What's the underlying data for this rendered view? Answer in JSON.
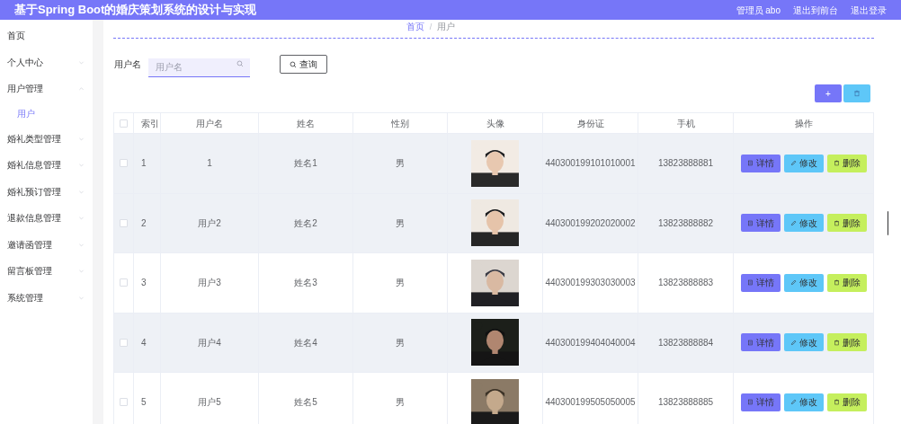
{
  "header": {
    "title": "基于Spring Boot的婚庆策划系统的设计与实现",
    "user": "管理员 abo",
    "links": [
      "退出到前台",
      "退出登录"
    ]
  },
  "sidebar": {
    "items": [
      {
        "label": "首页",
        "kind": "link"
      },
      {
        "label": "个人中心",
        "kind": "menu",
        "expanded": false
      },
      {
        "label": "用户管理",
        "kind": "menu",
        "expanded": true,
        "children": [
          {
            "label": "用户",
            "selected": true
          }
        ]
      },
      {
        "label": "婚礼类型管理",
        "kind": "menu",
        "expanded": false
      },
      {
        "label": "婚礼信息管理",
        "kind": "menu",
        "expanded": false
      },
      {
        "label": "婚礼预订管理",
        "kind": "menu",
        "expanded": false
      },
      {
        "label": "退款信息管理",
        "kind": "menu",
        "expanded": false
      },
      {
        "label": "邀请函管理",
        "kind": "menu",
        "expanded": false
      },
      {
        "label": "留言板管理",
        "kind": "menu",
        "expanded": false
      },
      {
        "label": "系统管理",
        "kind": "menu",
        "expanded": false
      }
    ]
  },
  "breadcrumb": {
    "items": [
      "首页",
      "用户"
    ],
    "separator": "/"
  },
  "search": {
    "label": "用户名",
    "placeholder": "用户名",
    "button": "查询"
  },
  "toolbar": {
    "add": "+"
  },
  "table": {
    "columns": [
      "索引",
      "用户名",
      "姓名",
      "性别",
      "头像",
      "身份证",
      "手机",
      "操作"
    ],
    "header_checked": false,
    "rows": [
      {
        "checked": false,
        "highlighted": true,
        "index": "1",
        "username": "1",
        "name": "姓名1",
        "gender": "男",
        "id_card": "440300199101010001",
        "phone": "13823888881",
        "actions": [
          "详情",
          "修改",
          "删除"
        ]
      },
      {
        "checked": false,
        "highlighted": true,
        "index": "2",
        "username": "用户2",
        "name": "姓名2",
        "gender": "男",
        "id_card": "440300199202020002",
        "phone": "13823888882",
        "actions": [
          "详情",
          "修改",
          "删除"
        ]
      },
      {
        "checked": false,
        "highlighted": false,
        "index": "3",
        "username": "用户3",
        "name": "姓名3",
        "gender": "男",
        "id_card": "440300199303030003",
        "phone": "13823888883",
        "actions": [
          "详情",
          "修改",
          "删除"
        ]
      },
      {
        "checked": false,
        "highlighted": true,
        "index": "4",
        "username": "用户4",
        "name": "姓名4",
        "gender": "男",
        "id_card": "440300199404040004",
        "phone": "13823888884",
        "actions": [
          "详情",
          "修改",
          "删除"
        ]
      },
      {
        "checked": false,
        "highlighted": false,
        "index": "5",
        "username": "用户5",
        "name": "姓名5",
        "gender": "男",
        "id_card": "440300199505050005",
        "phone": "13823888885",
        "actions": [
          "详情",
          "修改",
          "删除"
        ]
      }
    ]
  }
}
